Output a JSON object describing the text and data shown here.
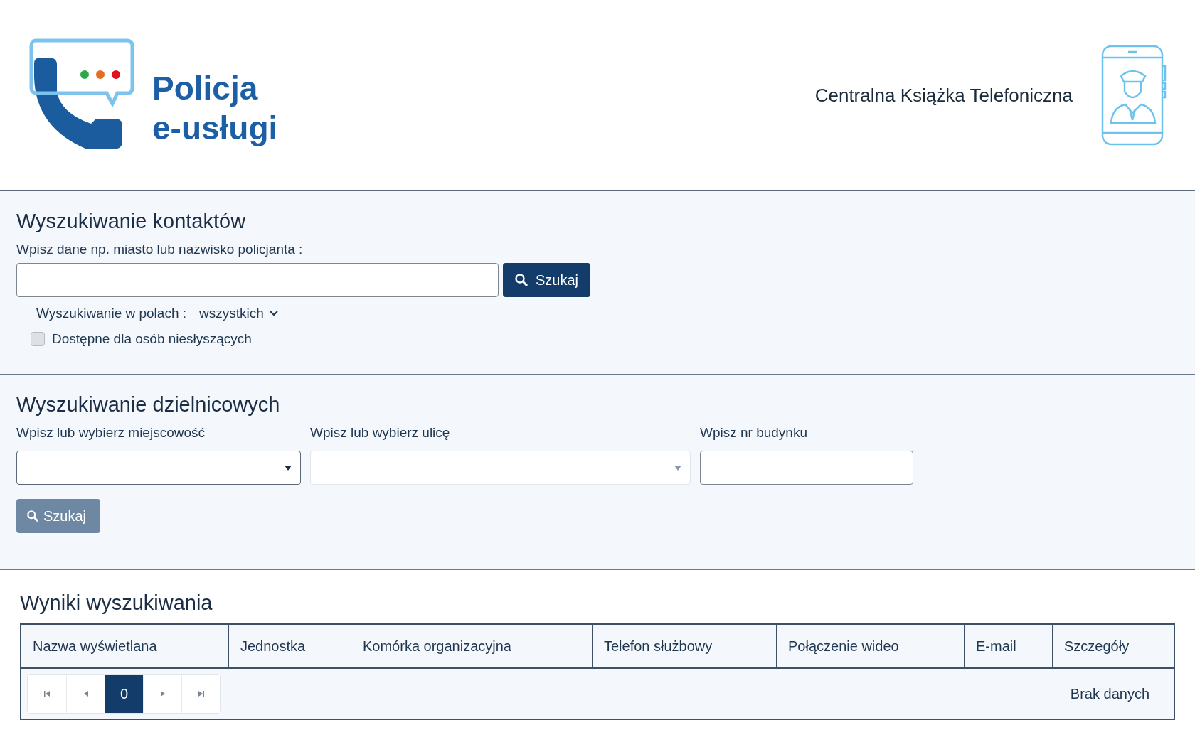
{
  "header": {
    "logo_line_1": "Policja",
    "logo_line_2": "e-usługi",
    "title": "Centralna Książka Telefoniczna"
  },
  "contact_search": {
    "heading": "Wyszukiwanie kontaktów",
    "label": "Wpisz dane np. miasto lub nazwisko policjanta :",
    "button": "Szukaj",
    "fields_label": "Wyszukiwanie w polach :",
    "fields_value": "wszystkich",
    "deaf_checkbox": {
      "label": "Dostępne dla osób niesłyszących",
      "checked": false
    }
  },
  "officer_search": {
    "heading": "Wyszukiwanie dzielnicowych",
    "fields": [
      {
        "kind": "select",
        "label": "Wpisz lub wybierz miejscowość",
        "disabled": false
      },
      {
        "kind": "select",
        "label": "Wpisz lub wybierz ulicę",
        "disabled": true
      },
      {
        "kind": "text",
        "label": "Wpisz nr budynku",
        "disabled": false
      }
    ],
    "button": {
      "label": "Szukaj",
      "disabled": true
    }
  },
  "results": {
    "heading": "Wyniki wyszukiwania",
    "columns": [
      "Nazwa wyświetlana",
      "Jednostka",
      "Komórka organizacyjna",
      "Telefon służbowy",
      "Połączenie wideo",
      "E-mail",
      "Szczegóły"
    ],
    "pager": [
      {
        "kind": "first"
      },
      {
        "kind": "prev"
      },
      {
        "kind": "page",
        "label": "0",
        "selected": true
      },
      {
        "kind": "next"
      },
      {
        "kind": "last"
      }
    ],
    "empty_text": "Brak danych"
  }
}
